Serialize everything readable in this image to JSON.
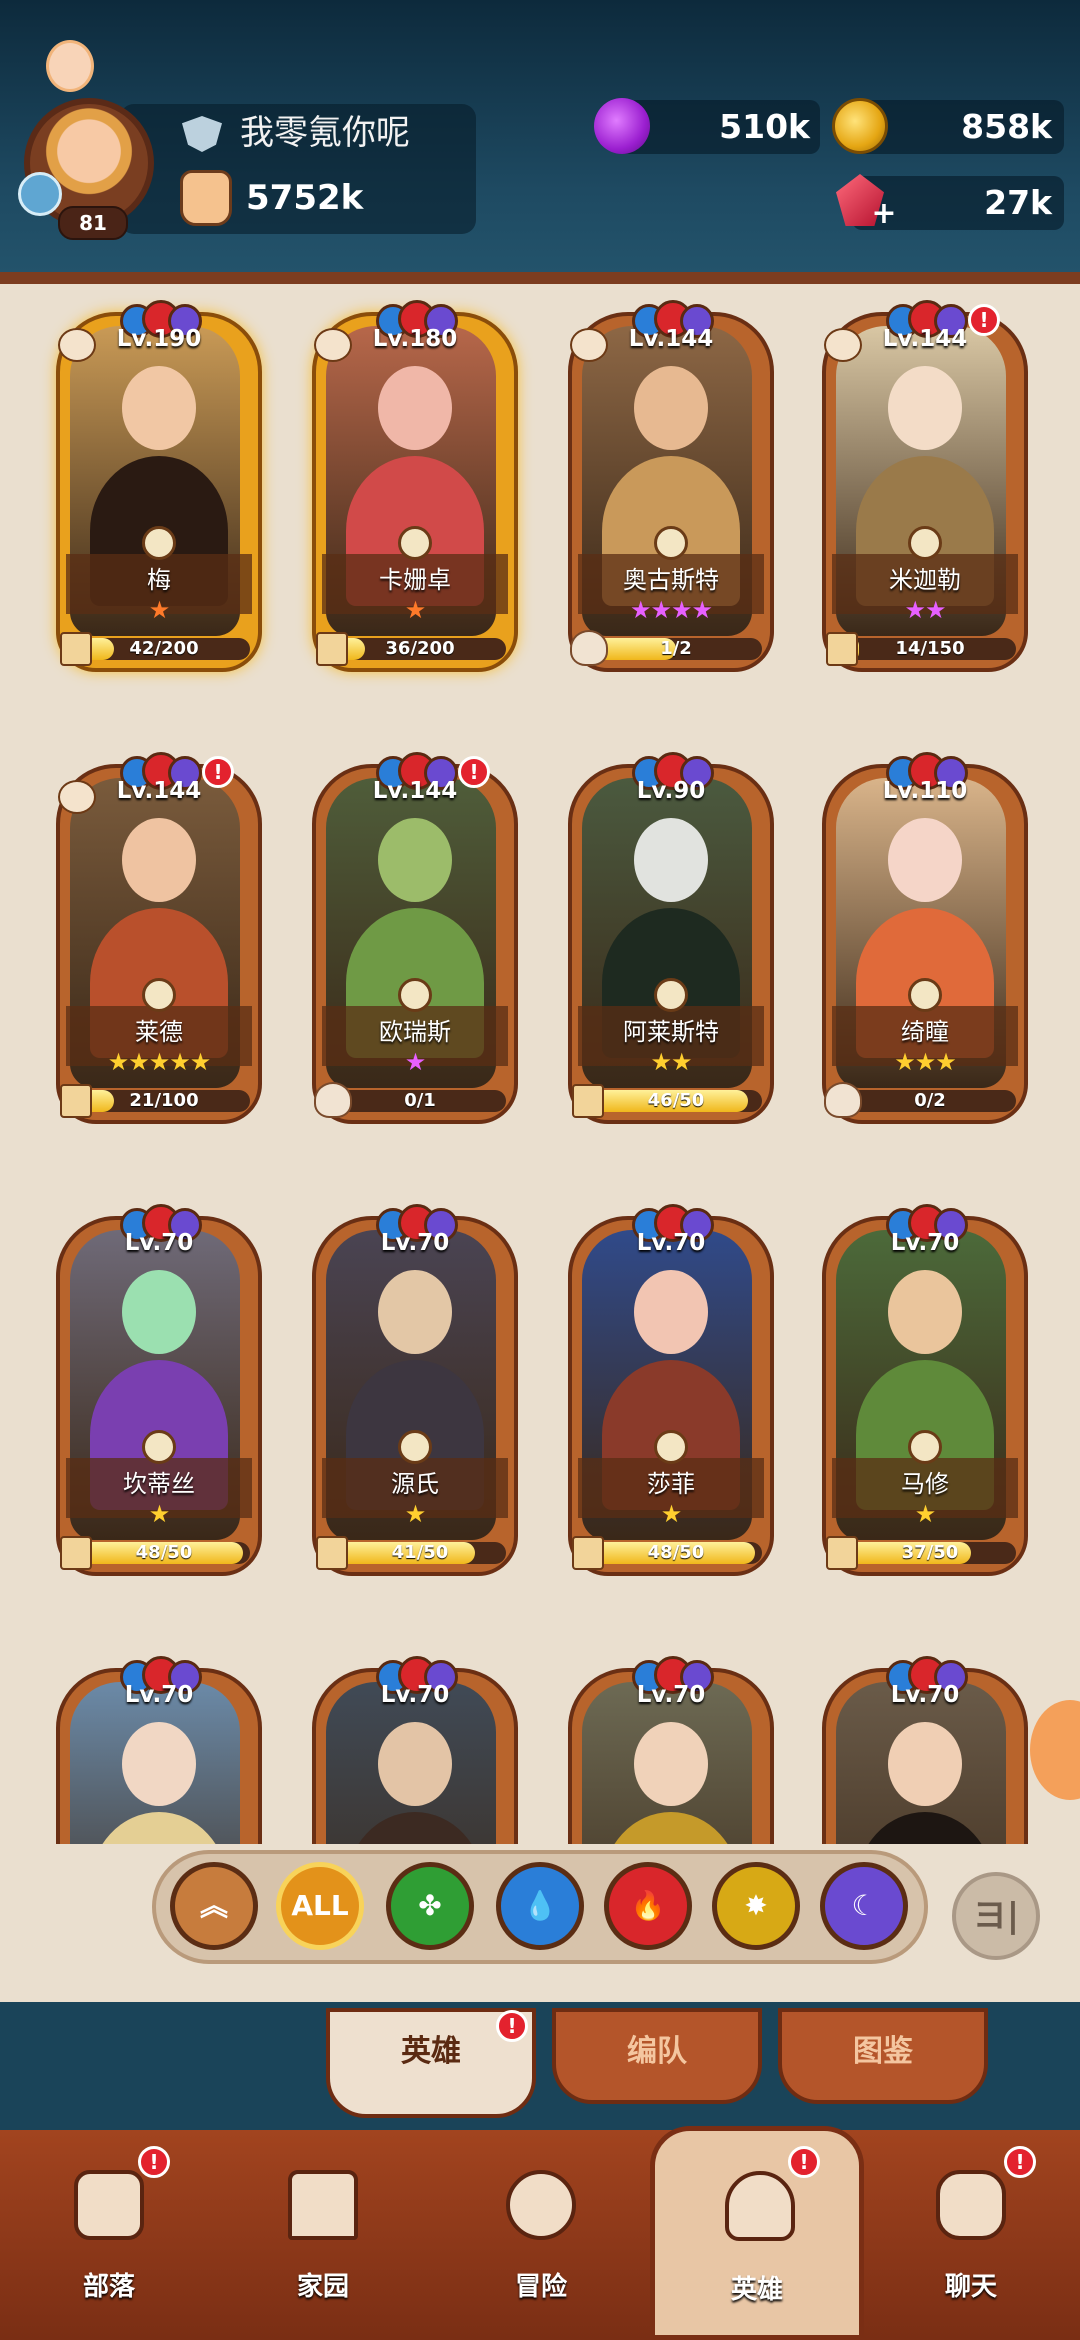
{
  "player": {
    "name": "我零氪你呢",
    "level": "81",
    "power": "5752k"
  },
  "resources": {
    "elixir": "510k",
    "gold": "858k",
    "gems": "27k"
  },
  "colors": {
    "fire": "#d9262b",
    "nature": "#2f9e34",
    "water": "#2a7ed8",
    "light": "#d7a915",
    "dark": "#6a4ad0"
  },
  "heroes": [
    {
      "level": "Lv.190",
      "name": "梅",
      "stars": "★",
      "star_color": "orange",
      "progress": "42/200",
      "progress_fraction": 0.21,
      "rarity": "gold"
    },
    {
      "level": "Lv.180",
      "name": "卡姗卓",
      "stars": "★",
      "star_color": "orange",
      "progress": "36/200",
      "progress_fraction": 0.18,
      "rarity": "gold"
    },
    {
      "level": "Lv.144",
      "name": "奥古斯特",
      "stars": "★★★★",
      "star_color": "purple",
      "progress": "1/2",
      "progress_fraction": 0.5,
      "rarity": "normal"
    },
    {
      "level": "Lv.144",
      "name": "米迦勒",
      "stars": "★★",
      "star_color": "purple",
      "progress": "14/150",
      "progress_fraction": 0.09,
      "rarity": "normal"
    },
    {
      "level": "Lv.144",
      "name": "莱德",
      "stars": "★★★★★",
      "star_color": "gold",
      "progress": "21/100",
      "progress_fraction": 0.21,
      "rarity": "normal"
    },
    {
      "level": "Lv.144",
      "name": "欧瑞斯",
      "stars": "★",
      "star_color": "purple",
      "progress": "0/1",
      "progress_fraction": 0,
      "rarity": "normal"
    },
    {
      "level": "Lv.90",
      "name": "阿莱斯特",
      "stars": "★★",
      "star_color": "gold",
      "progress": "46/50",
      "progress_fraction": 0.92,
      "rarity": "normal"
    },
    {
      "level": "Lv.110",
      "name": "绮瞳",
      "stars": "★★★",
      "star_color": "gold",
      "progress": "0/2",
      "progress_fraction": 0,
      "rarity": "normal"
    },
    {
      "level": "Lv.70",
      "name": "坎蒂丝",
      "stars": "★",
      "star_color": "gold",
      "progress": "48/50",
      "progress_fraction": 0.96,
      "rarity": "normal"
    },
    {
      "level": "Lv.70",
      "name": "源氏",
      "stars": "★",
      "star_color": "gold",
      "progress": "41/50",
      "progress_fraction": 0.82,
      "rarity": "normal"
    },
    {
      "level": "Lv.70",
      "name": "莎菲",
      "stars": "★",
      "star_color": "gold",
      "progress": "48/50",
      "progress_fraction": 0.96,
      "rarity": "normal"
    },
    {
      "level": "Lv.70",
      "name": "马修",
      "stars": "★",
      "star_color": "gold",
      "progress": "37/50",
      "progress_fraction": 0.74,
      "rarity": "normal"
    },
    {
      "level": "Lv.70",
      "name": "",
      "stars": "",
      "star_color": "gold",
      "progress": "",
      "progress_fraction": 0,
      "rarity": "normal"
    },
    {
      "level": "Lv.70",
      "name": "",
      "stars": "",
      "star_color": "gold",
      "progress": "",
      "progress_fraction": 0,
      "rarity": "normal"
    },
    {
      "level": "Lv.70",
      "name": "",
      "stars": "",
      "star_color": "gold",
      "progress": "",
      "progress_fraction": 0,
      "rarity": "normal"
    },
    {
      "level": "Lv.70",
      "name": "",
      "stars": "",
      "star_color": "gold",
      "progress": "",
      "progress_fraction": 0,
      "rarity": "normal"
    }
  ],
  "filters": {
    "all_label": "ALL",
    "sort_label": "ヨ|"
  },
  "subtabs": {
    "heroes": "英雄",
    "formation": "编队",
    "codex": "图鉴"
  },
  "nav": {
    "tribe": "部落",
    "home": "家园",
    "adventure": "冒险",
    "heroes": "英雄",
    "chat": "聊天"
  },
  "alerts": {
    "mark": "!"
  }
}
